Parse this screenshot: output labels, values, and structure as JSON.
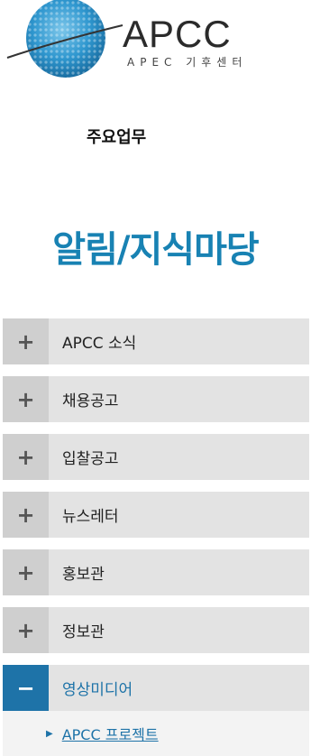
{
  "brand": {
    "name": "APCC",
    "subtitle": "APEC 기후센터",
    "globe_color": "#2f97cf"
  },
  "nav": {
    "main_item": "주요업무"
  },
  "section": {
    "title": "알림/지식마당"
  },
  "menu": {
    "expand_symbol": "+",
    "collapse_symbol": "−",
    "items": [
      {
        "label": "APCC 소식"
      },
      {
        "label": "채용공고"
      },
      {
        "label": "입찰공고"
      },
      {
        "label": "뉴스레터"
      },
      {
        "label": "홍보관"
      },
      {
        "label": "정보관"
      }
    ],
    "active": {
      "label": "영상미디어",
      "sub_items": [
        {
          "label": "APCC 프로젝트"
        }
      ]
    }
  },
  "colors": {
    "accent": "#1882b3",
    "active_toggle": "#1e73a8",
    "menu_bg": "#e3e3e3"
  }
}
